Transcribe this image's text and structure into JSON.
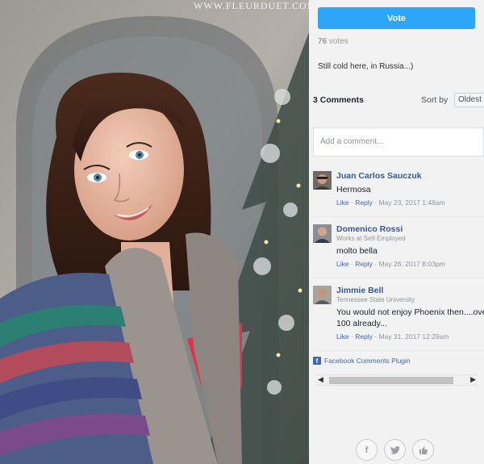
{
  "photo": {
    "watermark": "WWW.FLEURDUET.COM",
    "alt": "Portrait of a smiling woman in a striped knit cardigan beside a Christmas tree"
  },
  "panel": {
    "vote_label": "Vote",
    "votes_count": "76",
    "votes_label": "votes",
    "caption": "Still cold here, in Russia...)"
  },
  "comments": {
    "count_label": "3 Comments",
    "sort_label": "Sort by",
    "sort_selected": "Oldest",
    "input_placeholder": "Add a comment...",
    "items": [
      {
        "name": "Juan Carlos Sauczuk",
        "subtitle": "",
        "text": "Hermosa",
        "like": "Like",
        "reply": "Reply",
        "date": "May 23, 2017 1:48am"
      },
      {
        "name": "Domenico Rossi",
        "subtitle": "Works at Self-Employed",
        "text": "molto bella",
        "like": "Like",
        "reply": "Reply",
        "date": "May 26, 2017 8:03pm"
      },
      {
        "name": "Jimmie Bell",
        "subtitle": "Tennessee State University",
        "text": "You would not enjoy Phoenix then....over",
        "text_line2": "100 already...",
        "like": "Like",
        "reply": "Reply",
        "date": "May 31, 2017 12:29am"
      }
    ],
    "plugin_label": "Facebook Comments Plugin"
  },
  "share": {
    "icons": [
      "facebook-icon",
      "twitter-icon",
      "thumbs-up-icon"
    ]
  }
}
